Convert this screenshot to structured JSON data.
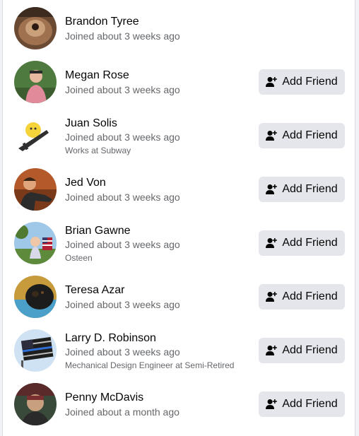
{
  "people": [
    {
      "name": "Brandon Tyree",
      "joined": "Joined about 3 weeks ago",
      "extra": "",
      "button": ""
    },
    {
      "name": "Megan Rose",
      "joined": "Joined about 3 weeks ago",
      "extra": "",
      "button": "Add Friend"
    },
    {
      "name": "Juan Solis",
      "joined": "Joined about 3 weeks ago",
      "extra": "Works at Subway",
      "button": "Add Friend"
    },
    {
      "name": "Jed Von",
      "joined": "Joined about 3 weeks ago",
      "extra": "",
      "button": "Add Friend"
    },
    {
      "name": "Brian Gawne",
      "joined": "Joined about 3 weeks ago",
      "extra": "Osteen",
      "button": "Add Friend"
    },
    {
      "name": "Teresa Azar",
      "joined": "Joined about 3 weeks ago",
      "extra": "",
      "button": "Add Friend"
    },
    {
      "name": "Larry D. Robinson",
      "joined": "Joined about 3 weeks ago",
      "extra": "Mechanical Design Engineer at Semi-Retired",
      "button": "Add Friend"
    },
    {
      "name": "Penny McDavis",
      "joined": "Joined about a month ago",
      "extra": "",
      "button": "Add Friend"
    }
  ],
  "icons": {
    "add_friend": "add-friend-icon"
  },
  "colors": {
    "button_bg": "#e4e6eb",
    "secondary_text": "#65676b",
    "primary_text": "#050505"
  }
}
